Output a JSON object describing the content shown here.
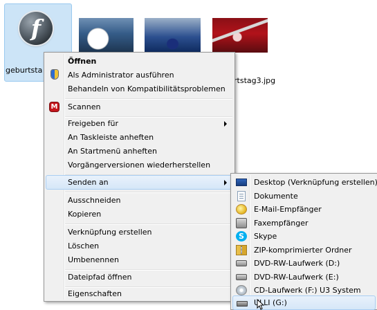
{
  "files": [
    {
      "label": "geburtsta",
      "selected": true,
      "icon": "flash-icon",
      "icon_letter": "f"
    },
    {
      "label": "",
      "icon": "photo-thumbnail"
    },
    {
      "label": "",
      "icon": "photo-thumbnail"
    },
    {
      "label": "rtstag3.jpg",
      "icon": "photo-thumbnail"
    }
  ],
  "context_menu": {
    "items": [
      {
        "label": "Öffnen",
        "bold": true
      },
      {
        "label": "Als Administrator ausführen",
        "icon": "shield-icon"
      },
      {
        "label": "Behandeln von Kompatibilitätsproblemen"
      },
      {
        "label": "Scannen",
        "icon": "mcafee-icon"
      },
      {
        "label": "Freigeben für",
        "submenu": true
      },
      {
        "label": "An Taskleiste anheften"
      },
      {
        "label": "An Startmenü anheften"
      },
      {
        "label": "Vorgängerversionen wiederherstellen"
      },
      {
        "label": "Senden an",
        "submenu": true,
        "highlighted": true
      },
      {
        "label": "Ausschneiden"
      },
      {
        "label": "Kopieren"
      },
      {
        "label": "Verknüpfung erstellen"
      },
      {
        "label": "Löschen"
      },
      {
        "label": "Umbenennen"
      },
      {
        "label": "Dateipfad öffnen"
      },
      {
        "label": "Eigenschaften"
      }
    ]
  },
  "send_to_menu": {
    "items": [
      {
        "label": "Desktop (Verknüpfung erstellen)",
        "icon": "desktop-icon"
      },
      {
        "label": "Dokumente",
        "icon": "documents-icon"
      },
      {
        "label": "E-Mail-Empfänger",
        "icon": "mail-icon"
      },
      {
        "label": "Faxempfänger",
        "icon": "fax-icon"
      },
      {
        "label": "Skype",
        "icon": "skype-icon"
      },
      {
        "label": "ZIP-komprimierter Ordner",
        "icon": "zip-folder-icon"
      },
      {
        "label": "DVD-RW-Laufwerk (D:)",
        "icon": "dvd-drive-icon"
      },
      {
        "label": "DVD-RW-Laufwerk (E:)",
        "icon": "dvd-drive-icon"
      },
      {
        "label": "CD-Laufwerk (F:) U3 System",
        "icon": "cd-drive-icon"
      },
      {
        "label": "ULLI (G:)",
        "icon": "usb-drive-icon",
        "highlighted": true
      }
    ]
  }
}
